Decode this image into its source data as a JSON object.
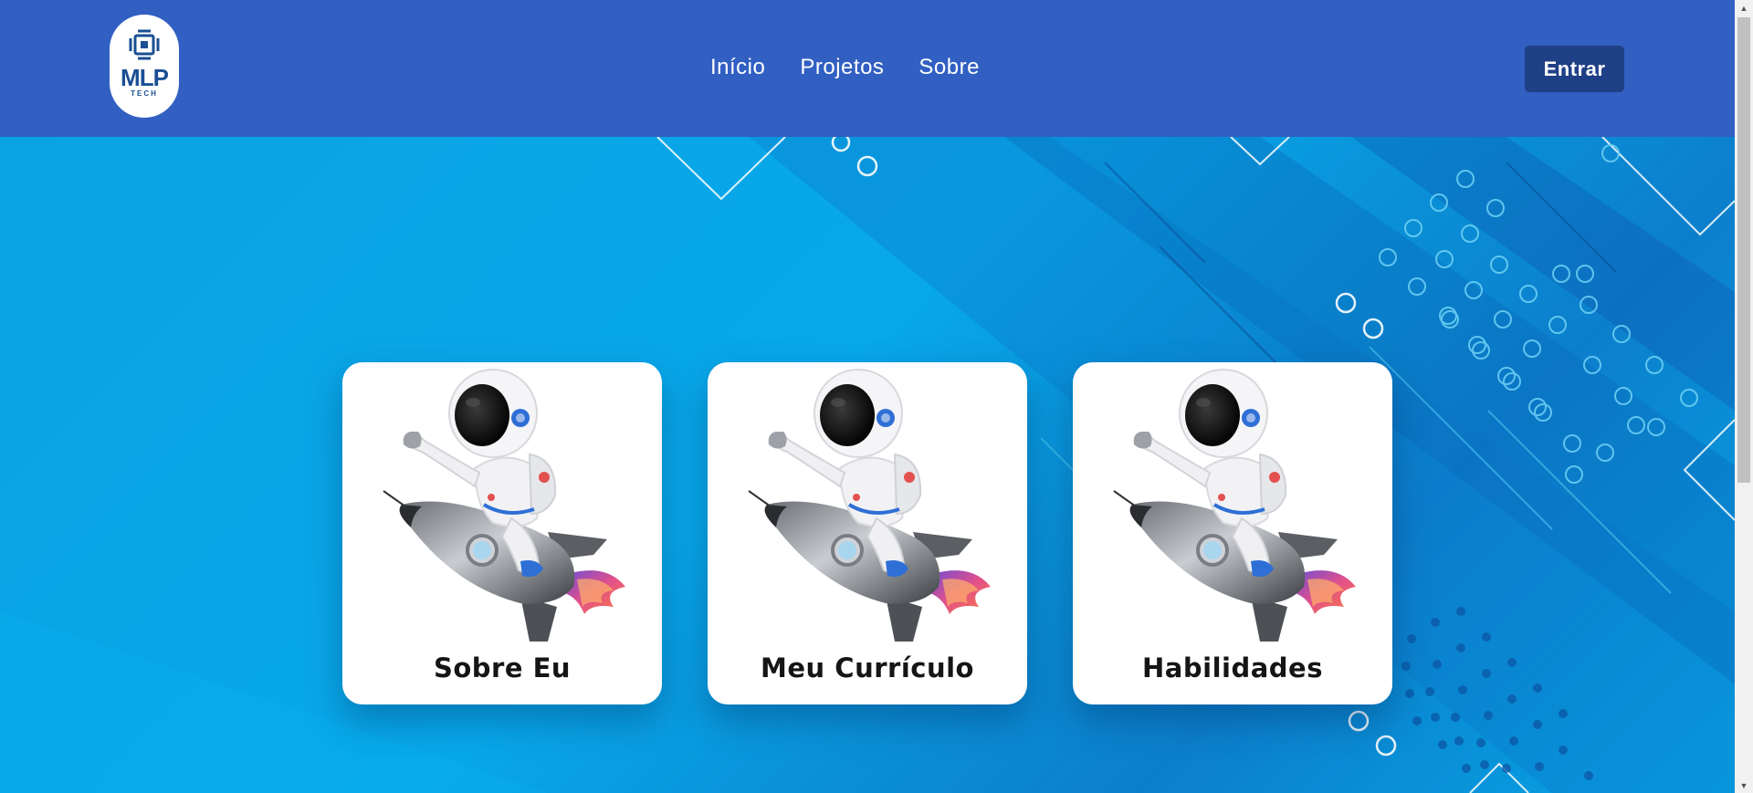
{
  "logo": {
    "name": "MLP",
    "tagline": "TECH"
  },
  "nav": {
    "items": [
      {
        "label": "Início"
      },
      {
        "label": "Projetos"
      },
      {
        "label": "Sobre"
      }
    ]
  },
  "header": {
    "login_label": "Entrar"
  },
  "cards": [
    {
      "title": "Sobre Eu",
      "icon": "astronaut-rocket-icon"
    },
    {
      "title": "Meu Currículo",
      "icon": "astronaut-rocket-icon"
    },
    {
      "title": "Habilidades",
      "icon": "astronaut-rocket-icon"
    }
  ],
  "colors": {
    "header": "#315fc2",
    "login_button": "#1f3f86",
    "hero_blue": "#0aa6e6",
    "card_bg": "#ffffff"
  }
}
